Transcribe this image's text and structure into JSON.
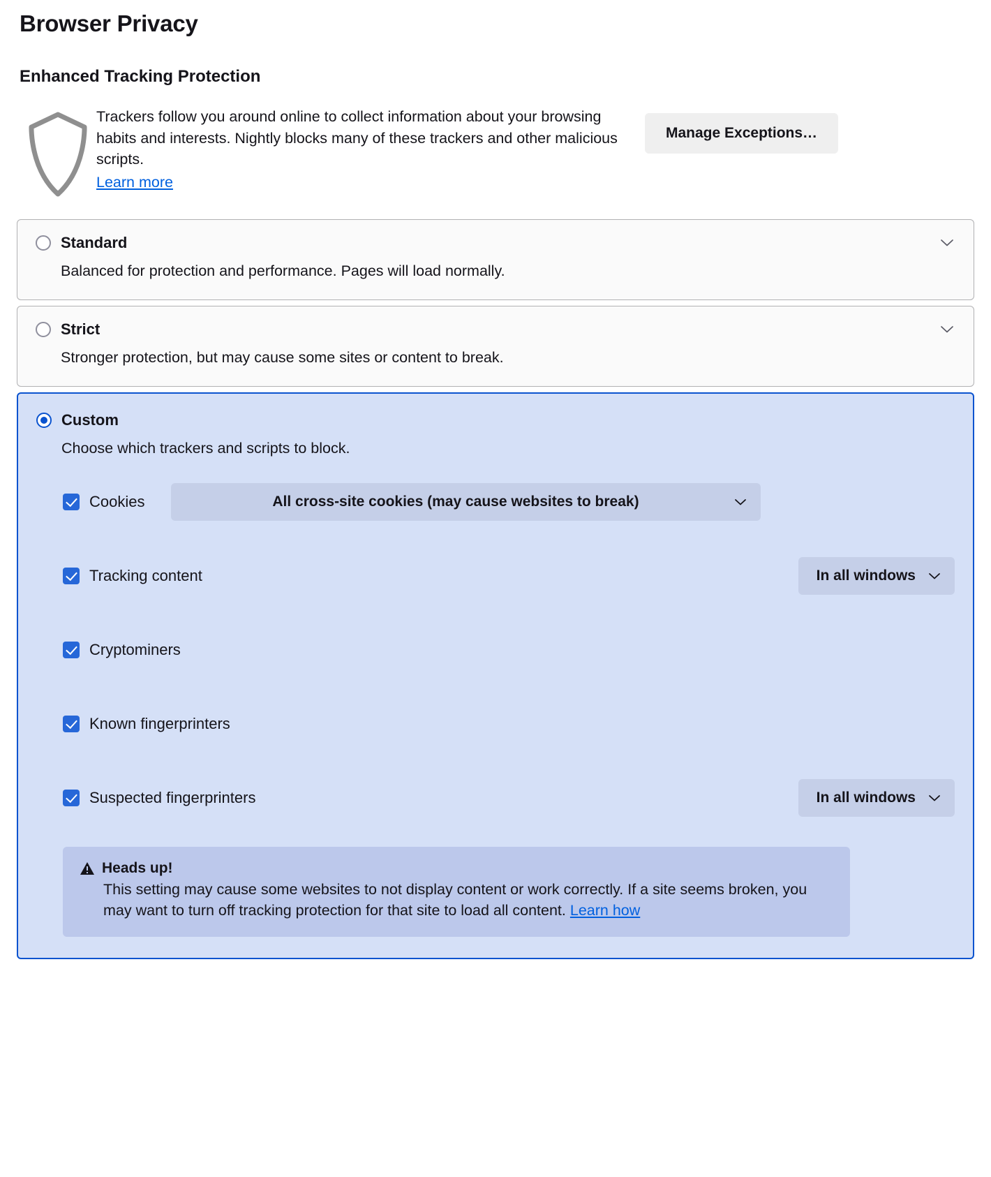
{
  "page": {
    "title": "Browser Privacy",
    "section_title": "Enhanced Tracking Protection"
  },
  "intro": {
    "icon": "shield-icon",
    "description": "Trackers follow you around online to collect information about your browsing habits and interests. Nightly blocks many of these trackers and other malicious scripts.",
    "learn_more": "Learn more",
    "manage_exceptions_label": "Manage Exceptions…"
  },
  "protection_levels": [
    {
      "id": "standard",
      "label": "Standard",
      "description": "Balanced for protection and performance. Pages will load normally.",
      "selected": false,
      "expand_icon": "chevron-down-icon"
    },
    {
      "id": "strict",
      "label": "Strict",
      "description": "Stronger protection, but may cause some sites or content to break.",
      "selected": false,
      "expand_icon": "chevron-down-icon"
    },
    {
      "id": "custom",
      "label": "Custom",
      "description": "Choose which trackers and scripts to block.",
      "selected": true
    }
  ],
  "custom_options": [
    {
      "id": "cookies",
      "label": "Cookies",
      "checked": true,
      "select": {
        "value": "All cross-site cookies (may cause websites to break)",
        "style": "wide",
        "chevron": "chevron-down-icon"
      }
    },
    {
      "id": "tracking-content",
      "label": "Tracking content",
      "checked": true,
      "select": {
        "value": "In all windows",
        "style": "narrow",
        "chevron": "chevron-down-icon"
      }
    },
    {
      "id": "cryptominers",
      "label": "Cryptominers",
      "checked": true,
      "select": null
    },
    {
      "id": "known-fingerprinters",
      "label": "Known fingerprinters",
      "checked": true,
      "select": null
    },
    {
      "id": "suspected-fingerprinters",
      "label": "Suspected fingerprinters",
      "checked": true,
      "select": {
        "value": "In all windows",
        "style": "narrow",
        "chevron": "chevron-down-icon"
      }
    }
  ],
  "warning": {
    "icon": "warning-triangle-icon",
    "title": "Heads up!",
    "body": "This setting may cause some websites to not display content or work correctly. If a site seems broken, you may want to turn off tracking protection for that site to load all content.",
    "link": "Learn how"
  },
  "colors": {
    "accent_blue": "#0a53cf",
    "link_blue": "#0060df",
    "checkbox_blue": "#2667d8",
    "selected_card_bg": "#d5e0f7",
    "select_bg": "#c5cfe8",
    "warning_bg": "#bcc8eb",
    "card_bg": "#fafafa",
    "card_border": "#b1b1b3",
    "button_bg": "#efefef",
    "text": "#15141a"
  }
}
